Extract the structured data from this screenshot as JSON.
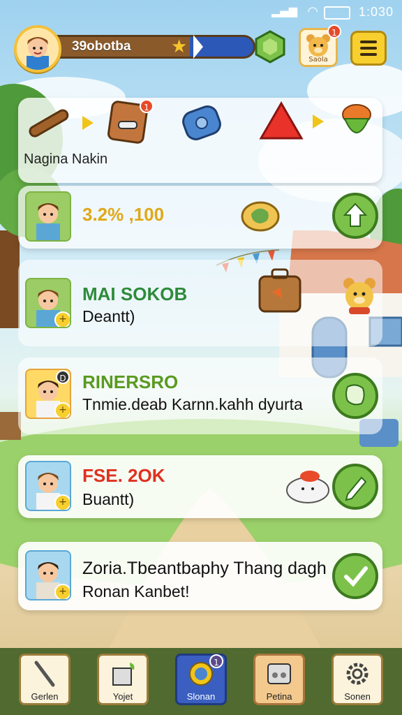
{
  "status_bar": {
    "time": "1:030"
  },
  "top_bar": {
    "player_label": "39obotba",
    "bear_button_label": "Saola",
    "bear_badge": "1"
  },
  "items_panel": {
    "title": "Nagina Nakin",
    "items": [
      "bat-icon",
      "box-icon",
      "barrel-icon",
      "gem-icon",
      "acorn-icon"
    ],
    "box_badge": "1"
  },
  "rows": [
    {
      "heading": "3.2% ,100",
      "heading_color": "#e0a81a",
      "subtext": "",
      "action_icon": "upgrade-icon"
    },
    {
      "heading": "MAI SOKOB",
      "heading_color": "#2e8b3a",
      "subtext": "Deantt)",
      "action_icon": ""
    },
    {
      "heading": "RINERSRO",
      "heading_color": "#5a9a20",
      "subtext": "Tnmie.deab Karnn.kahh dyurta",
      "avatar_badge": "D",
      "action_icon": "map-icon"
    },
    {
      "heading": "FSE. 2OK",
      "heading_color": "#e0301e",
      "subtext": "Buantt)",
      "action_icon": "pencil-icon"
    },
    {
      "heading": "Zoria.Tbeantbaphy Thang dagh",
      "heading_color": "#111111",
      "subtext": "Ronan Kanbet!",
      "action_icon": "check-icon"
    }
  ],
  "bottom_nav": [
    {
      "label": "Gerlen",
      "icon": "shovel-icon"
    },
    {
      "label": "Yojet",
      "icon": "crate-icon"
    },
    {
      "label": "Slonan",
      "icon": "compass-icon",
      "badge": "1"
    },
    {
      "label": "Petina",
      "icon": "machine-icon"
    },
    {
      "label": "Sonen",
      "icon": "gear-icon"
    }
  ]
}
